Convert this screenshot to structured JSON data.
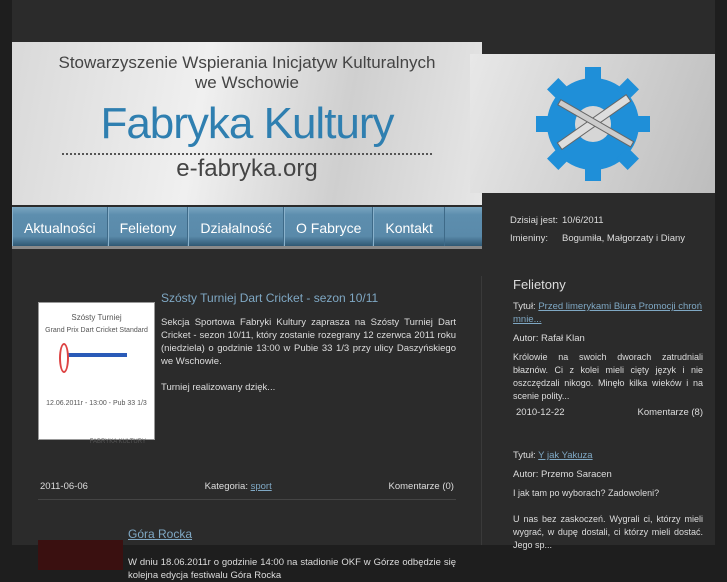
{
  "header": {
    "org_line1": "Stowarzyszenie Wspierania Inicjatyw Kulturalnych",
    "org_line2": "we Wschowie",
    "title": "Fabryka Kultury",
    "url": "e-fabryka.org"
  },
  "nav": [
    "Aktualności",
    "Felietony",
    "Działalność",
    "O Fabryce",
    "Kontakt"
  ],
  "info": {
    "date_label": "Dzisiaj jest:",
    "date": "10/6/2011",
    "names_label": "Imieniny:",
    "names": "Bogumiła, Małgorzaty i Diany"
  },
  "posts": [
    {
      "title": "Szósty Turniej Dart Cricket - sezon 10/11",
      "thumb_lines": [
        "Szósty Turniej",
        "Grand Prix Dart Cricket Standard",
        "12.06.2011r - 13:00 - Pub 33 1/3",
        "FABRYKA KULTURY"
      ],
      "text": "Sekcja Sportowa Fabryki Kultury zaprasza na Szósty Turniej Dart Cricket - sezon 10/11, który zostanie rozegrany 12 czerwca 2011 roku (niedziela) o godzinie 13:00 w Pubie 33 1/3 przy ulicy Daszyńskiego we Wschowie.",
      "text2": "Turniej realizowany dzięk...",
      "date": "2011-06-06",
      "category_label": "Kategoria:",
      "category": "sport",
      "comments": "Komentarze (0)"
    },
    {
      "title": "Góra Rocka",
      "text": "W dniu 18.06.2011r o godzinie 14:00 na stadionie OKF w Górze odbędzie się kolejna edycja festiwalu Góra Rocka"
    }
  ],
  "sidebar": {
    "heading": "Felietony",
    "items": [
      {
        "title_label": "Tytuł:",
        "title": "Przed limerykami Biura Promocji chroń mnie...",
        "author": "Autor: Rafał Klan",
        "excerpt": "Królowie na swoich dworach zatrudniali błaznów. Ci z kolei mieli cięty język i nie oszczędzali nikogo. Minęło kilka wieków i na scenie polity...",
        "date": "2010-12-22",
        "comments": "Komentarze (8)"
      },
      {
        "title_label": "Tytuł:",
        "title": "Y jak Yakuza",
        "author": "Autor: Przemo Saracen",
        "excerpt": "I jak tam po wyborach? Zadowoleni?",
        "excerpt2": "U nas bez zaskoczeń. Wygrali ci, którzy mieli wygrać, w dupę dostali, ci którzy mieli dostać. Jego sp..."
      }
    ]
  }
}
